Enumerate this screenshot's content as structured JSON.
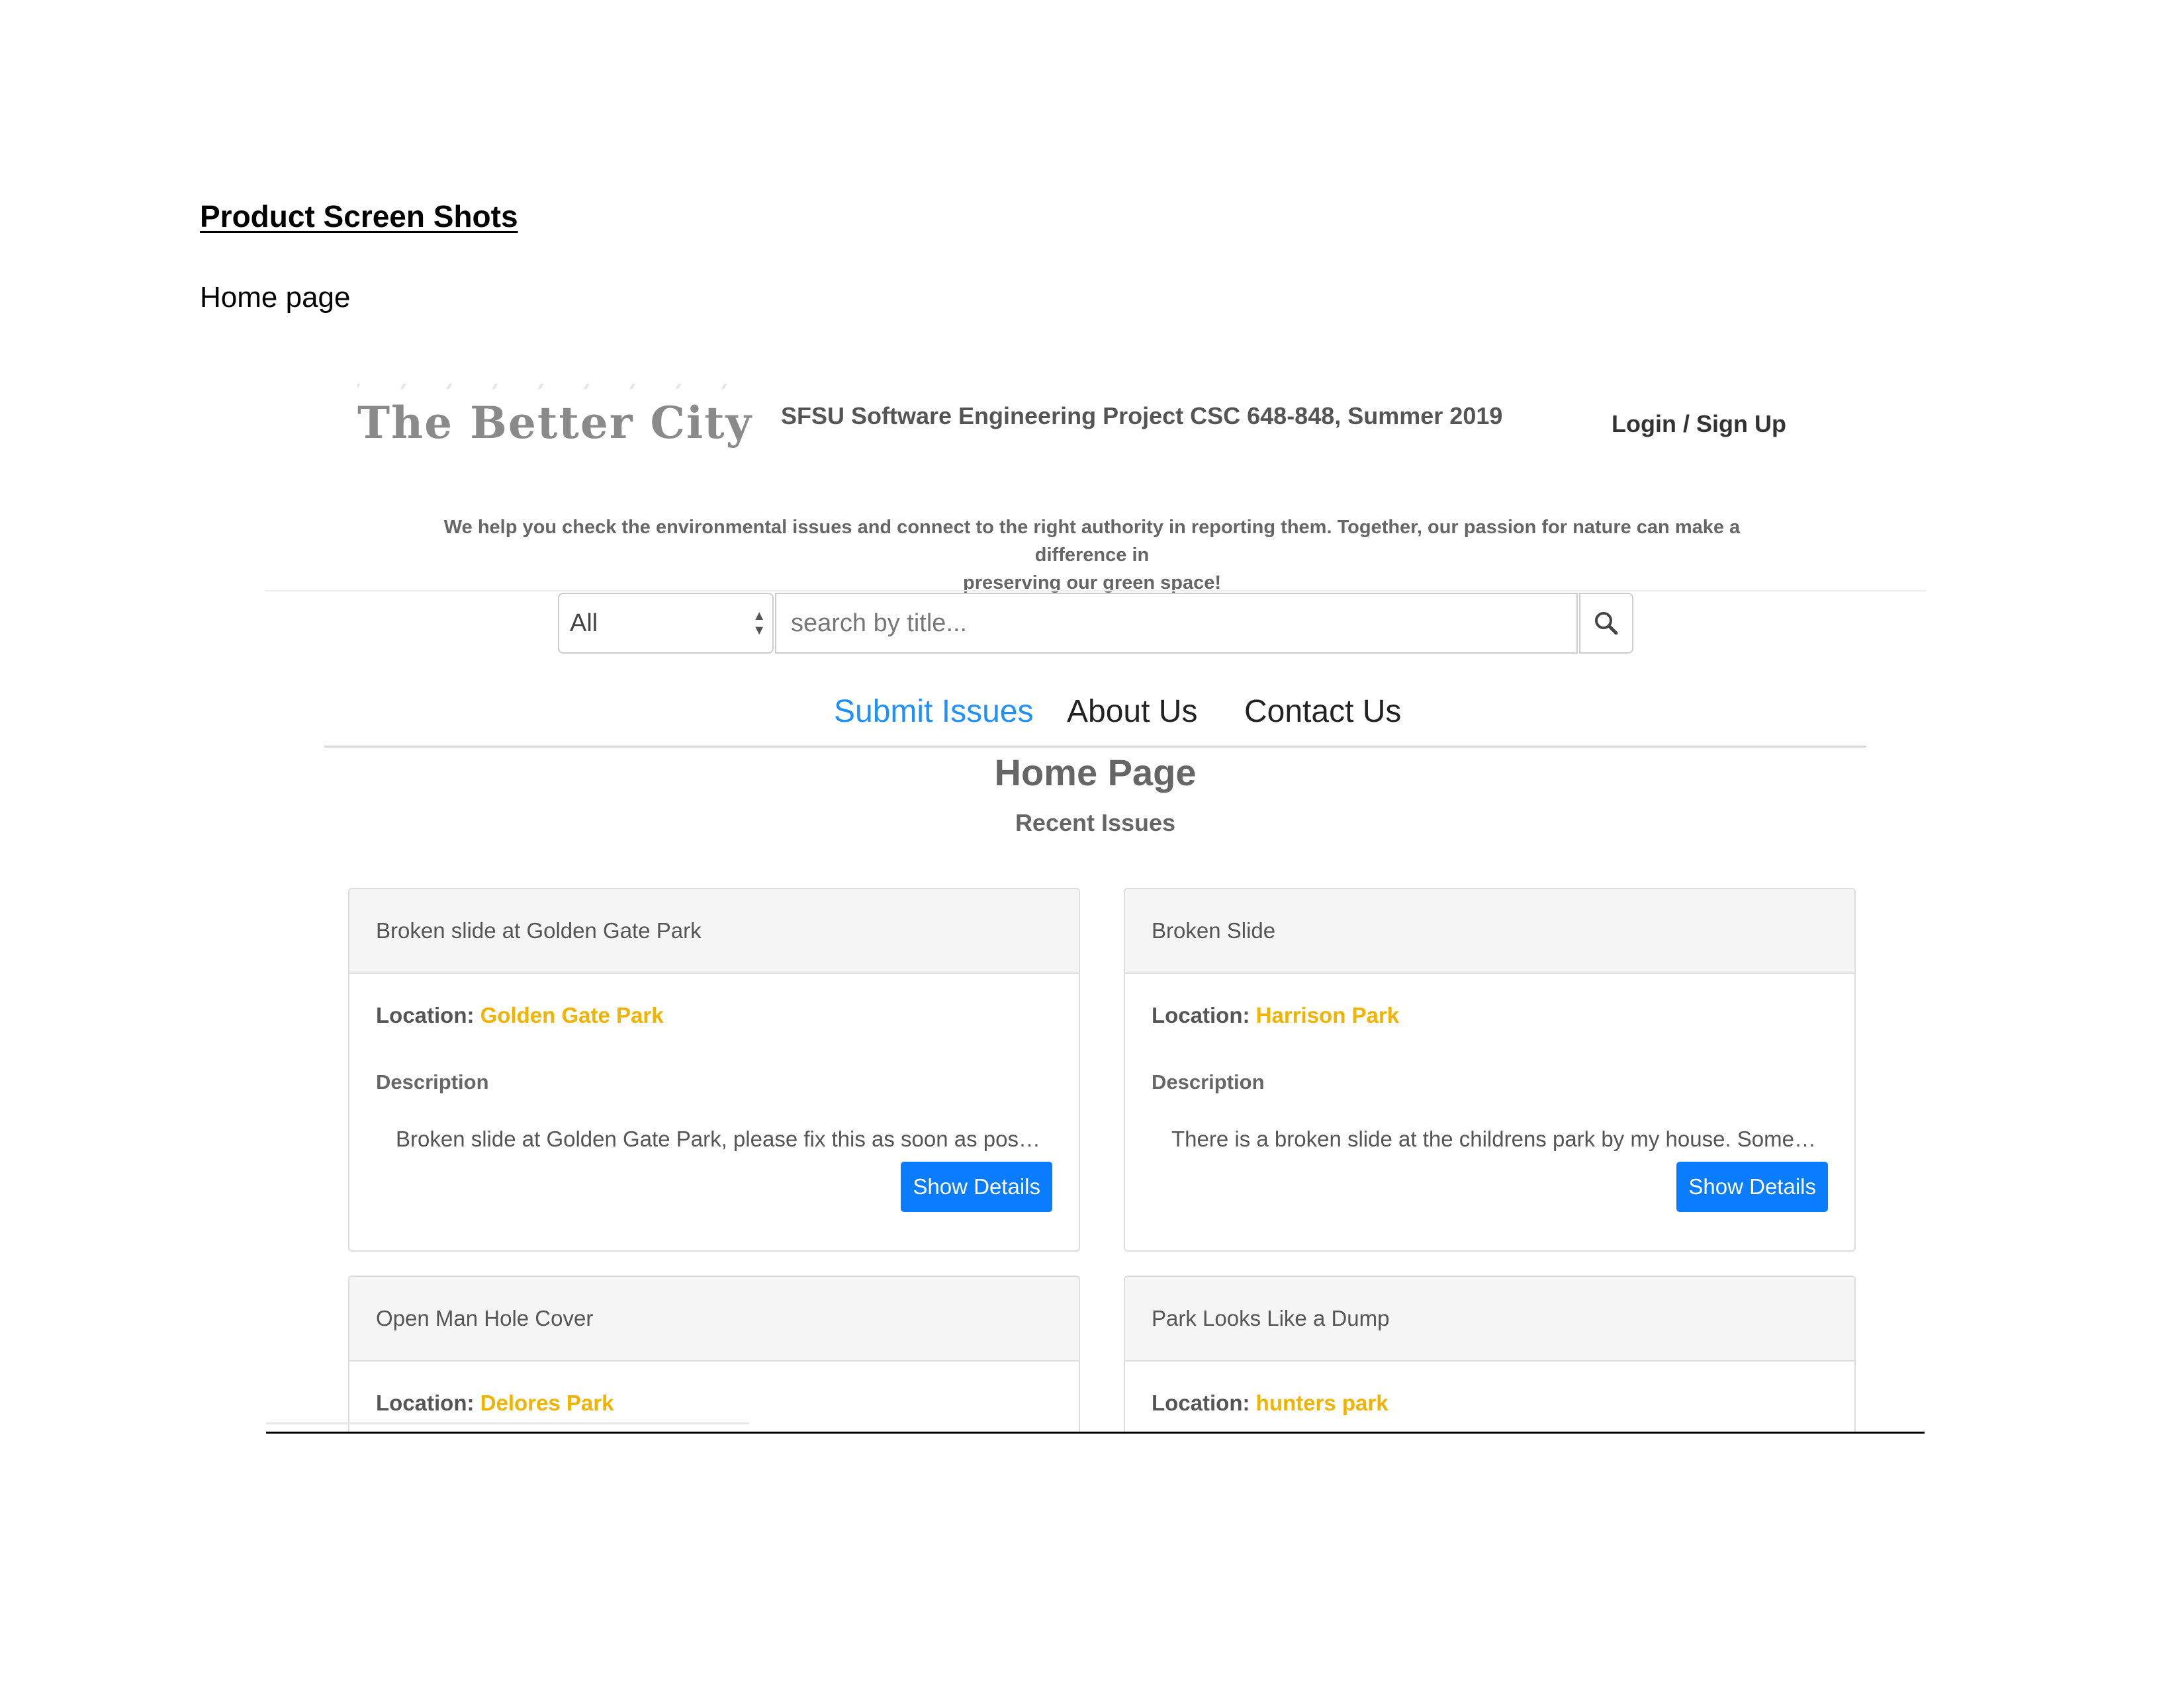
{
  "document": {
    "heading": "Product Screen Shots",
    "caption": "Home page"
  },
  "site": {
    "logo_text": "The Better City",
    "project_title": "SFSU Software Engineering Project CSC 648-848, Summer 2019",
    "login_label": "Login / Sign Up",
    "tagline_line1": "We help you check the environmental issues and connect to the right authority in reporting them. Together, our passion for nature can make a difference in",
    "tagline_line2": "preserving our green space!"
  },
  "search": {
    "category_selected": "All",
    "placeholder": "search by title...",
    "icon": "search-icon"
  },
  "nav": {
    "items": [
      {
        "label": "Submit Issues",
        "active": true
      },
      {
        "label": "About Us",
        "active": false
      },
      {
        "label": "Contact Us",
        "active": false
      }
    ]
  },
  "main": {
    "page_title": "Home Page",
    "section_title": "Recent Issues"
  },
  "issues": [
    {
      "title": "Broken slide at Golden Gate Park",
      "location_label": "Location:",
      "location": "Golden Gate Park",
      "description_label": "Description",
      "description": "Broken slide at Golden Gate Park, please fix this as soon as possible!",
      "button_label": "Show Details"
    },
    {
      "title": "Broken Slide",
      "location_label": "Location:",
      "location": "Harrison Park",
      "description_label": "Description",
      "description": "There is a broken slide at the childrens park by my house. Someone sho...",
      "button_label": "Show Details"
    },
    {
      "title": "Open Man Hole Cover",
      "location_label": "Location:",
      "location": "Delores Park"
    },
    {
      "title": "Park Looks Like a Dump",
      "location_label": "Location:",
      "location": "hunters park"
    }
  ],
  "colors": {
    "accent_blue": "#0a7cff",
    "nav_active": "#1e90ff",
    "location_yellow": "#f0b400"
  }
}
